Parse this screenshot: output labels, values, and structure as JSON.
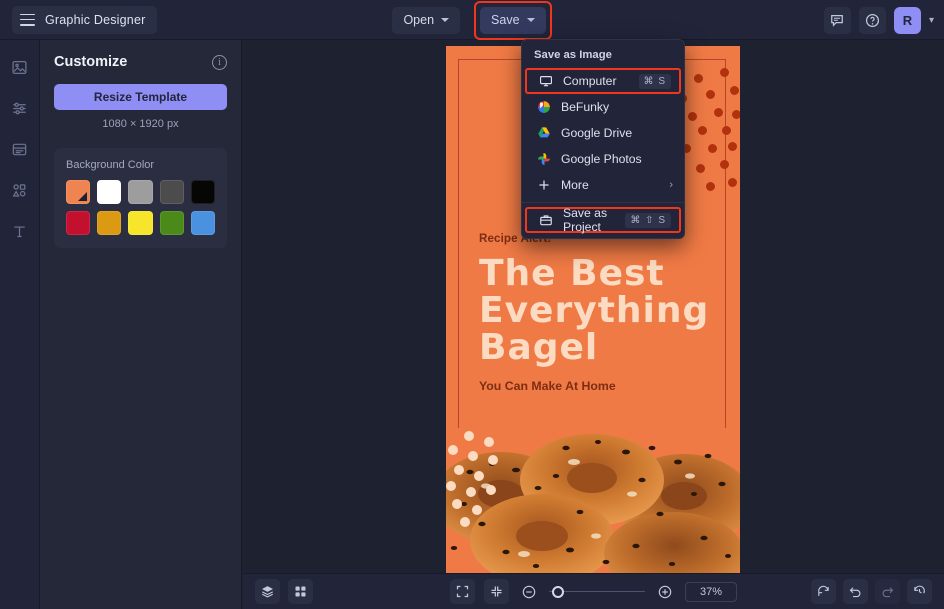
{
  "app": {
    "brand_label": "Graphic Designer",
    "accent": "#8e8ef5",
    "highlight": "#f2361c",
    "bg": "#1e2130"
  },
  "topbar": {
    "open_label": "Open",
    "save_label": "Save",
    "avatar_initial": "R"
  },
  "rail": {
    "items": [
      {
        "name": "image-icon"
      },
      {
        "name": "adjustments-icon"
      },
      {
        "name": "templates-icon"
      },
      {
        "name": "shapes-icon"
      },
      {
        "name": "text-icon"
      }
    ]
  },
  "panel": {
    "title": "Customize",
    "resize_label": "Resize Template",
    "dimensions": "1080 × 1920 px",
    "background_color_label": "Background Color",
    "swatches": [
      {
        "hex": "#ef8450",
        "selected": true
      },
      {
        "hex": "#ffffff",
        "selected": false
      },
      {
        "hex": "#9d9d9d",
        "selected": false
      },
      {
        "hex": "#4c4c4c",
        "selected": false
      },
      {
        "hex": "#060606",
        "selected": false
      },
      {
        "hex": "#c4102f",
        "selected": false
      },
      {
        "hex": "#dc9a13",
        "selected": false
      },
      {
        "hex": "#f6e52b",
        "selected": false
      },
      {
        "hex": "#4b8a19",
        "selected": false
      },
      {
        "hex": "#4a91e0",
        "selected": false
      }
    ]
  },
  "save_menu": {
    "header": "Save as Image",
    "items": [
      {
        "label": "Computer",
        "icon": "monitor-icon",
        "shortcut": "⌘ S",
        "highlighted": true
      },
      {
        "label": "BeFunky",
        "icon": "befunky-icon",
        "shortcut": "",
        "highlighted": false
      },
      {
        "label": "Google Drive",
        "icon": "google-drive-icon",
        "shortcut": "",
        "highlighted": false
      },
      {
        "label": "Google Photos",
        "icon": "google-photos-icon",
        "shortcut": "",
        "highlighted": false
      },
      {
        "label": "More",
        "icon": "plus-icon",
        "shortcut": "",
        "highlighted": false,
        "submenu": true
      }
    ],
    "project": {
      "label": "Save as Project",
      "icon": "briefcase-icon",
      "shortcut": "⌘ ⇧ S",
      "highlighted": true
    }
  },
  "canvas": {
    "kicker": "Recipe Alert!",
    "headline": "The Best\nEverything\nBagel",
    "subline": "You Can Make At Home",
    "bg_hex": "#f07a45",
    "headline_hex": "#fbdcc2",
    "accent_text_hex": "#7c2d12"
  },
  "bottombar": {
    "zoom_level": "37%",
    "buttons": [
      {
        "name": "layers-button"
      },
      {
        "name": "grid-button"
      },
      {
        "name": "fit-screen-button"
      },
      {
        "name": "shrink-button"
      },
      {
        "name": "zoom-out-button"
      },
      {
        "name": "zoom-in-button"
      },
      {
        "name": "reset-button"
      },
      {
        "name": "undo-button"
      },
      {
        "name": "redo-button"
      },
      {
        "name": "history-button"
      }
    ]
  }
}
